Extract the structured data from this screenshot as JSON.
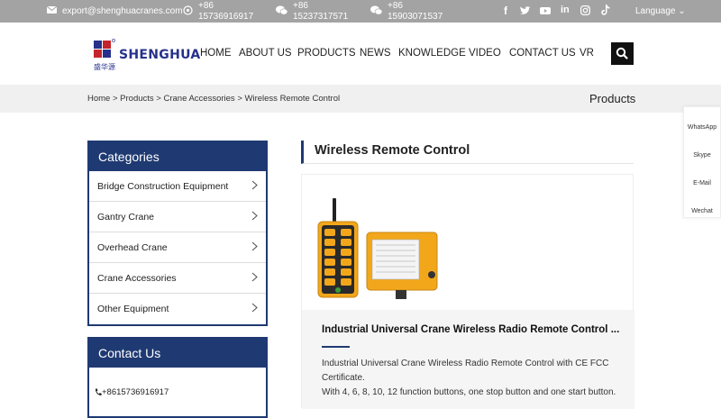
{
  "topbar": {
    "email": "export@shenghuacranes.com",
    "phone1_line1": "+86",
    "phone1_line2": "15736916917",
    "phone2_line1": "+86",
    "phone2_line2": "15237317571",
    "phone3_line1": "+86",
    "phone3_line2": "15903071537",
    "social_icons": [
      "facebook-icon",
      "twitter-icon",
      "youtube-icon",
      "linkedin-icon",
      "instagram-icon",
      "tiktok-icon"
    ],
    "language": "Language ⌄"
  },
  "header": {
    "logo_text": "SHENGHUA",
    "logo_cn": "盛华源",
    "nav": [
      "HOME",
      "ABOUT US",
      "PRODUCTS",
      "NEWS",
      "KNOWLEDGE",
      "VIDEO",
      "CONTACT US",
      "VR"
    ]
  },
  "breadcrumb": {
    "path": "Home > Products > Crane Accessories > Wireless Remote Control",
    "section_title": "Products"
  },
  "sidebar": {
    "categories_title": "Categories",
    "categories": [
      "Bridge Construction Equipment",
      "Gantry Crane",
      "Overhead Crane",
      "Crane Accessories",
      "Other Equipment"
    ],
    "contact_title": "Contact Us",
    "contact_phone": "+8615736916917"
  },
  "main": {
    "title": "Wireless Remote Control",
    "product_title": "Industrial Universal Crane Wireless Radio Remote Control ...",
    "product_desc_1": "Industrial Universal Crane Wireless Radio Remote Control with CE FCC Certificate.",
    "product_desc_2": "With 4, 6, 8, 10, 12 function buttons, one stop button and one start button."
  },
  "float": [
    "WhatsApp",
    "Skype",
    "E-Mail",
    "Wechat"
  ],
  "colors": {
    "topbar": "#a3a3a3",
    "brand_navy": "#1f3a72",
    "remote_orange": "#f2a71b"
  }
}
